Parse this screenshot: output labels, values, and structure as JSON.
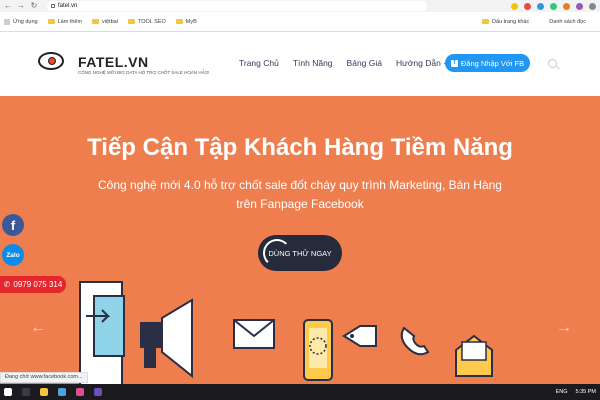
{
  "browser": {
    "url": "fatel.vn",
    "bookmarks": [
      {
        "label": "Ứng dụng",
        "kind": "apps"
      },
      {
        "label": "Làm thêm",
        "kind": "folder"
      },
      {
        "label": "việtbai",
        "kind": "folder"
      },
      {
        "label": "TOOL SEO",
        "kind": "folder"
      },
      {
        "label": "MyB",
        "kind": "folder"
      }
    ],
    "bookmarks_right": [
      "Dấu trang khác",
      "Danh sách đọc"
    ],
    "status_text": "Đang chờ www.facebook.com..."
  },
  "header": {
    "logo_text": "FATEL.VN",
    "logo_tagline": "CÔNG NGHỆ MỚI BIG DATA HỖ TRỢ CHỐT SALE HOÀN HẢO!",
    "menu": [
      {
        "label": "Trang Chủ"
      },
      {
        "label": "Tính Năng"
      },
      {
        "label": "Bảng Giá"
      },
      {
        "label": "Hướng Dẫn ·"
      }
    ],
    "fb_login_label": "Đăng Nhập Với FB"
  },
  "hero": {
    "title": "Tiếp Cận Tập Khách Hàng Tiềm Năng",
    "subtitle_line1": "Công nghệ mới 4.0 hỗ trợ chốt sale đốt cháy quy trình Marketing, Bán Hàng",
    "subtitle_line2": "trên Fanpage Facebook",
    "cta_label": "DÙNG THỬ NGAY",
    "prev_arrow": "←",
    "next_arrow": "→"
  },
  "floating": {
    "fb_glyph": "f",
    "zalo_label": "Zalo",
    "phone_icon": "✆",
    "phone": "0979 075 314"
  },
  "taskbar": {
    "lang": "ENG",
    "time": "5:35 PM"
  },
  "colors": {
    "hero_bg": "#ef7e4f",
    "fb_button": "#2196f3",
    "cta_bg": "#262b3b",
    "phone_bg": "#e4262d"
  }
}
